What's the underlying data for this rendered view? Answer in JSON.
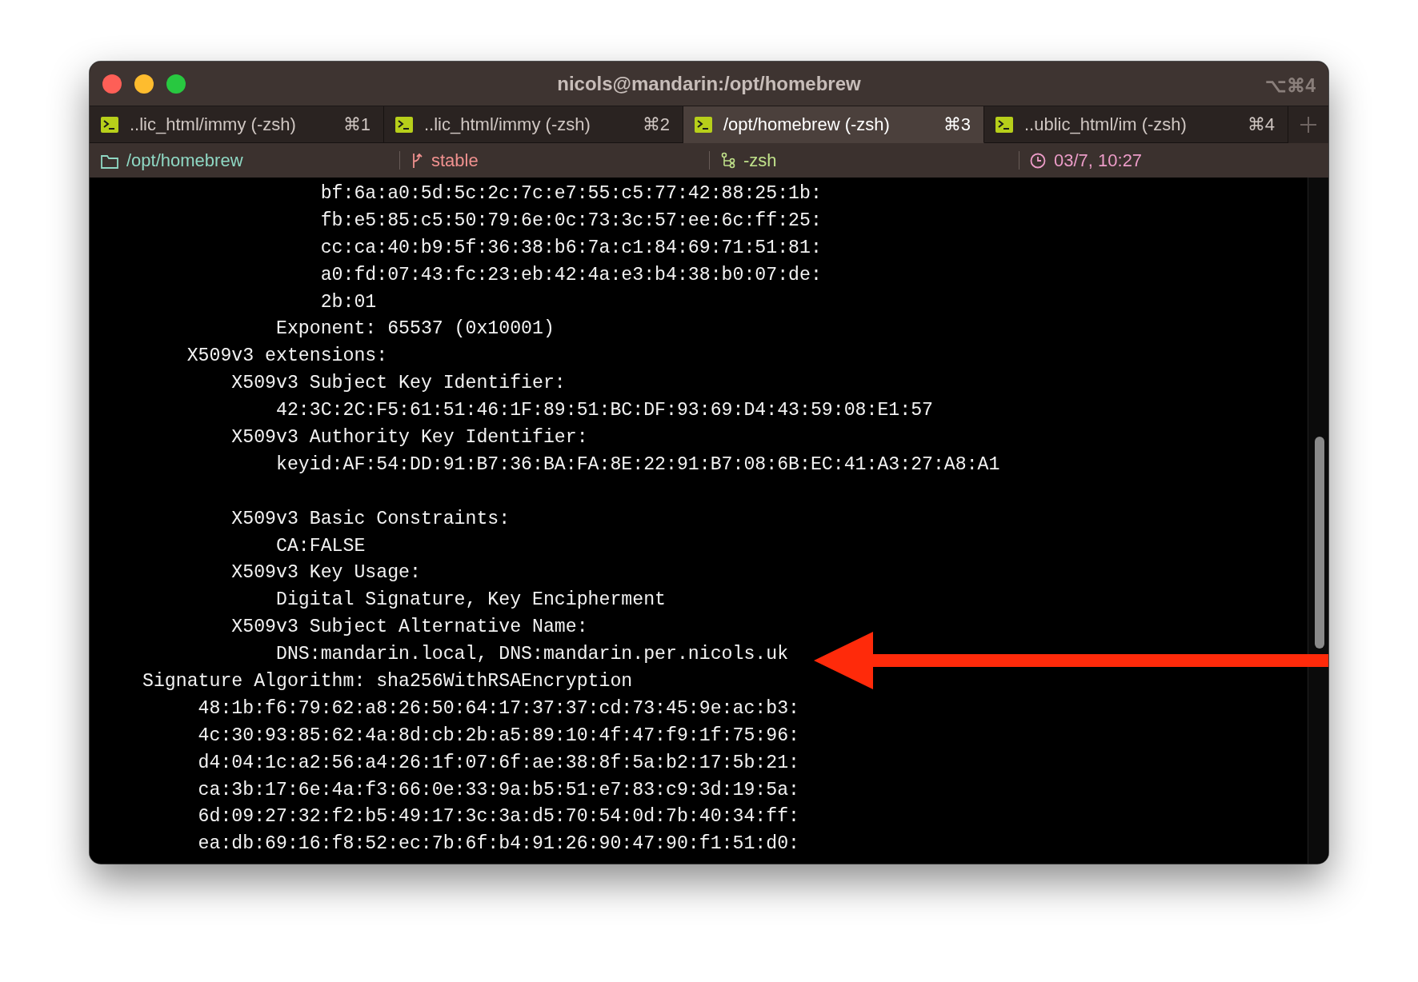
{
  "window": {
    "title": "nicols@mandarin:/opt/homebrew",
    "shortcut": "⌥⌘4"
  },
  "tabs": [
    {
      "label": "..lic_html/immy (-zsh)",
      "shortcut": "⌘1",
      "selected": false
    },
    {
      "label": "..lic_html/immy (-zsh)",
      "shortcut": "⌘2",
      "selected": false
    },
    {
      "label": "/opt/homebrew (-zsh)",
      "shortcut": "⌘3",
      "selected": true
    },
    {
      "label": "..ublic_html/im (-zsh)",
      "shortcut": "⌘4",
      "selected": false
    }
  ],
  "status_bar": {
    "items": [
      {
        "kind": "folder",
        "text": "/opt/homebrew",
        "color": "#8fd8c4"
      },
      {
        "kind": "branch",
        "text": "stable",
        "color": "#f0918f"
      },
      {
        "kind": "job",
        "text": "-zsh",
        "color": "#bfe08a"
      },
      {
        "kind": "clock",
        "text": "03/7, 10:27",
        "color": "#ec9cc8"
      }
    ]
  },
  "terminal": {
    "blocks": [
      [
        "                bf:6a:a0:5d:5c:2c:7c:e7:55:c5:77:42:88:25:1b:",
        "                fb:e5:85:c5:50:79:6e:0c:73:3c:57:ee:6c:ff:25:",
        "                cc:ca:40:b9:5f:36:38:b6:7a:c1:84:69:71:51:81:",
        "                a0:fd:07:43:fc:23:eb:42:4a:e3:b4:38:b0:07:de:",
        "                2b:01",
        "            Exponent: 65537 (0x10001)",
        "    X509v3 extensions:",
        "        X509v3 Subject Key Identifier:",
        "            42:3C:2C:F5:61:51:46:1F:89:51:BC:DF:93:69:D4:43:59:08:E1:57",
        "        X509v3 Authority Key Identifier:",
        "            keyid:AF:54:DD:91:B7:36:BA:FA:8E:22:91:B7:08:6B:EC:41:A3:27:A8:A1"
      ],
      [
        "        X509v3 Basic Constraints:",
        "            CA:FALSE",
        "        X509v3 Key Usage:",
        "            Digital Signature, Key Encipherment",
        "        X509v3 Subject Alternative Name:",
        "            DNS:mandarin.local, DNS:mandarin.per.nicols.uk",
        "Signature Algorithm: sha256WithRSAEncryption",
        "     48:1b:f6:79:62:a8:26:50:64:17:37:37:cd:73:45:9e:ac:b3:",
        "     4c:30:93:85:62:4a:8d:cb:2b:a5:89:10:4f:47:f9:1f:75:96:",
        "     d4:04:1c:a2:56:a4:26:1f:07:6f:ae:38:8f:5a:b2:17:5b:21:",
        "     ca:3b:17:6e:4a:f3:66:0e:33:9a:b5:51:e7:83:c9:3d:19:5a:",
        "     6d:09:27:32:f2:b5:49:17:3c:3a:d5:70:54:0d:7b:40:34:ff:",
        "     ea:db:69:16:f8:52:ec:7b:6f:b4:91:26:90:47:90:f1:51:d0:"
      ]
    ]
  }
}
